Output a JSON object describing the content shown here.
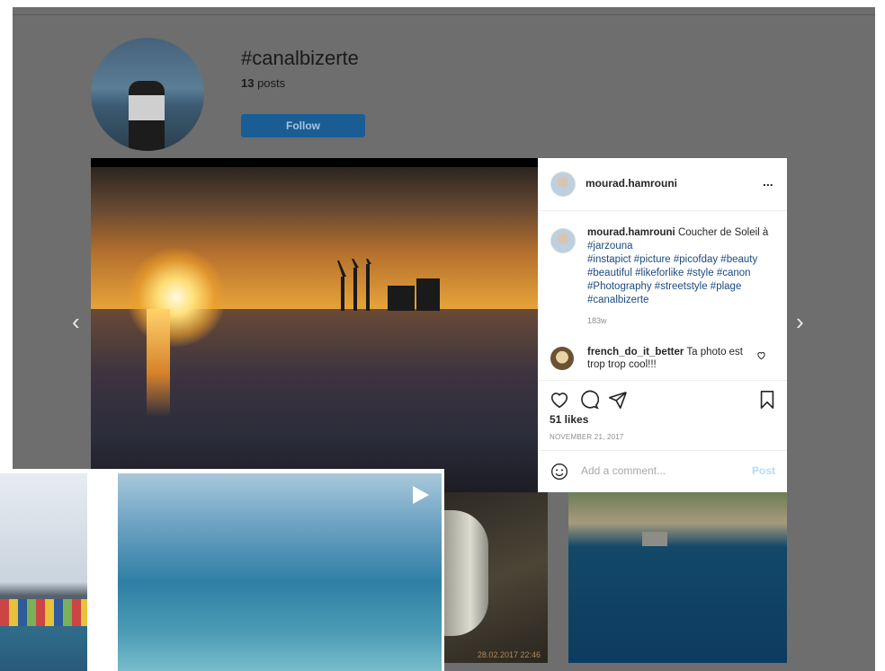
{
  "hashtag": {
    "title": "#canalbizerte",
    "post_count": "13",
    "posts_label": " posts",
    "follow_label": "Follow"
  },
  "post": {
    "username": "mourad.hamrouni",
    "more_label": "...",
    "caption_user": "mourad.hamrouni",
    "caption_text": " Coucher de Soleil à ",
    "caption_location": "#jarzouna",
    "caption_tags": "#instapict #picture #picofday #beauty #beautiful #likeforlike #style #canon #Photography #streetstyle #plage #canalbizerte",
    "caption_time": "183w",
    "comment_user": "french_do_it_better",
    "comment_text": " Ta photo est trop trop cool!!!",
    "likes": "51 likes",
    "date": "NOVEMBER 21, 2017",
    "comment_placeholder": "Add a comment...",
    "post_button": "Post"
  },
  "nav": {
    "prev_arrow": "‹",
    "next_arrow": "›"
  },
  "tiles": {
    "car_timestamp": "28.02.2017 22:46"
  },
  "colors": {
    "follow_button": "#1a5d95",
    "link": "#1b4a7e",
    "post_button": "#b3dbff"
  },
  "icons": [
    "heart-icon",
    "comment-icon",
    "share-icon",
    "bookmark-icon",
    "emoji-icon",
    "play-icon",
    "chevron-left-icon",
    "chevron-right-icon"
  ]
}
